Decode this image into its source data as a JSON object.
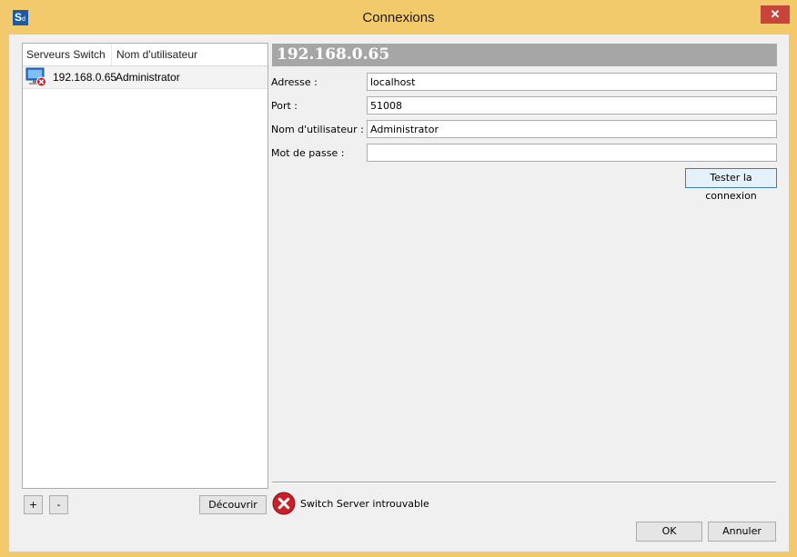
{
  "window": {
    "title": "Connexions",
    "app_icon_letter": "S",
    "app_icon_sub": "d",
    "close_glyph": "✕"
  },
  "server_list": {
    "columns": [
      "Serveurs Switch",
      "Nom d'utilisateur"
    ],
    "rows": [
      {
        "icon": "server-disconnected-icon",
        "server": "192.168.0.65",
        "user": "Administrator"
      }
    ]
  },
  "list_buttons": {
    "add_label": "+",
    "remove_label": "-",
    "discover_label": "Découvrir"
  },
  "details": {
    "header": "192.168.0.65",
    "address_label": "Adresse :",
    "address_value": "localhost",
    "port_label": "Port :",
    "port_value": "51008",
    "user_label": "Nom d'utilisateur :",
    "user_value": "Administrator",
    "password_label": "Mot de passe :",
    "password_value": "",
    "test_button": "Tester la connexion"
  },
  "status": {
    "icon": "error-icon",
    "text": "Switch Server introuvable"
  },
  "footer": {
    "ok_label": "OK",
    "cancel_label": "Annuler"
  },
  "colors": {
    "frame": "#f2c96b",
    "close_button": "#c7443b",
    "header_bar": "#a6a6a6",
    "error": "#c8202a",
    "app_icon": "#1a5aa8"
  }
}
